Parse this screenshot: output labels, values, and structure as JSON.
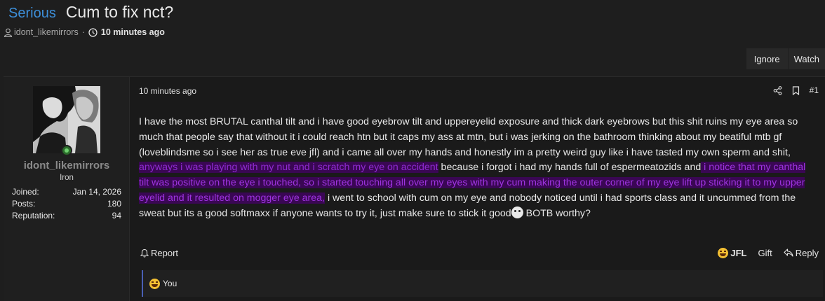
{
  "thread": {
    "prefix": "Serious",
    "title": "Cum to fix nct?",
    "author": "idont_likemirrors",
    "separator": "·",
    "time": "10 minutes ago"
  },
  "actions": {
    "ignore": "Ignore",
    "watch": "Watch"
  },
  "user": {
    "name": "idont_likemirrors",
    "rank": "Iron",
    "stats": [
      {
        "label": "Joined:",
        "value": "Jan 14, 2026"
      },
      {
        "label": "Posts:",
        "value": "180"
      },
      {
        "label": "Reputation:",
        "value": "94"
      }
    ]
  },
  "post": {
    "time": "10 minutes ago",
    "number": "#1",
    "text_1": "I have the most BRUTAL canthal tilt and i have good eyebrow tilt and uppereyelid exposure and thick dark eyebrows but this shit ruins my eye area so much that people say that without it i could reach htn but it caps my ass at mtn, but i was jerking on the bathroom thinking about my beatiful mtb gf (loveblindsme so i see her as true eve jfl) and i came all over my hands and honestly im a pretty weird guy like i have tasted my own sperm and shit,",
    "highlight_1": " anyways i was playing with my nut and i scratch my eye on accident",
    "text_2": " because i forgot i had my hands full of espermeatozids and",
    "highlight_2": " i notice that my canthal tilt was positive on the eye i touched, so i started touching all over my eyes with my cum making the outer corner of my eye lift up sticking it to my upper eyelid and it resulted on mogger eye area,",
    "text_3": " i went to school with cum on my eye and nobody noticed until i had sports class and it uncummed from the sweat but its a good softmaxx if anyone wants to try it, just make sure to stick it good",
    "text_4": " BOTB worthy?"
  },
  "footer": {
    "report": "Report",
    "jfl": "JFL",
    "gift": "Gift",
    "reply": "Reply"
  },
  "reactions": {
    "text": "You"
  },
  "colors": {
    "prefix": "#3d8fd9",
    "highlight_bg": "#3a0754",
    "highlight_fg": "#8f2bd1",
    "online": "#6ed06e"
  }
}
